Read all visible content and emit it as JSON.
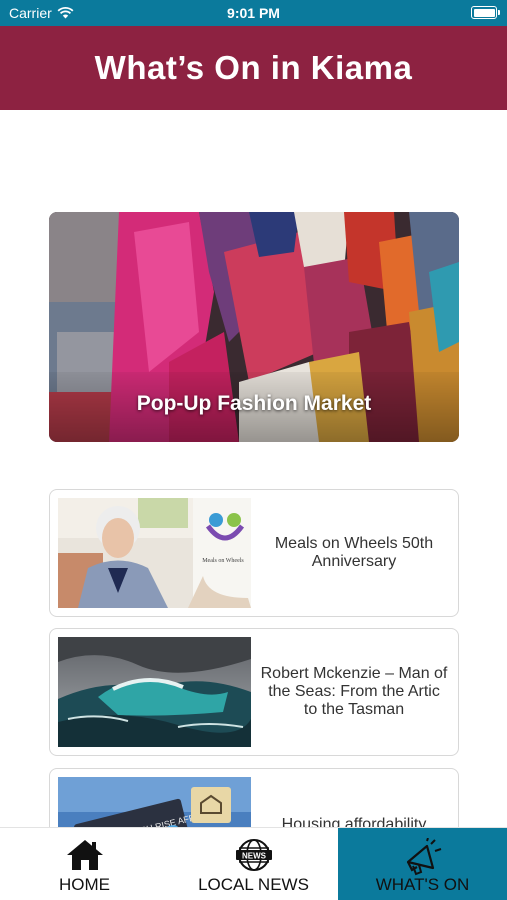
{
  "status_bar": {
    "carrier": "Carrier",
    "time": "9:01 PM"
  },
  "header": {
    "title": "What’s On in Kiama"
  },
  "featured": {
    "caption": "Pop-Up Fashion Market"
  },
  "events": [
    {
      "title": "Meals on Wheels 50th Anniversary",
      "logo_text": "Meals on Wheels"
    },
    {
      "title": "Robert Mckenzie – Man of the Seas: From the Artic to the Tasman"
    },
    {
      "title": "Housing affordability",
      "sign_text": "HOW MUCH RISE AFFORD"
    }
  ],
  "tabs": [
    {
      "label": "HOME",
      "icon": "home-icon"
    },
    {
      "label": "LOCAL NEWS",
      "icon": "news-globe-icon"
    },
    {
      "label": "WHAT'S ON",
      "icon": "megaphone-icon",
      "active": true
    }
  ],
  "colors": {
    "brand_maroon": "#8d2241",
    "brand_teal": "#0b7a9c"
  }
}
